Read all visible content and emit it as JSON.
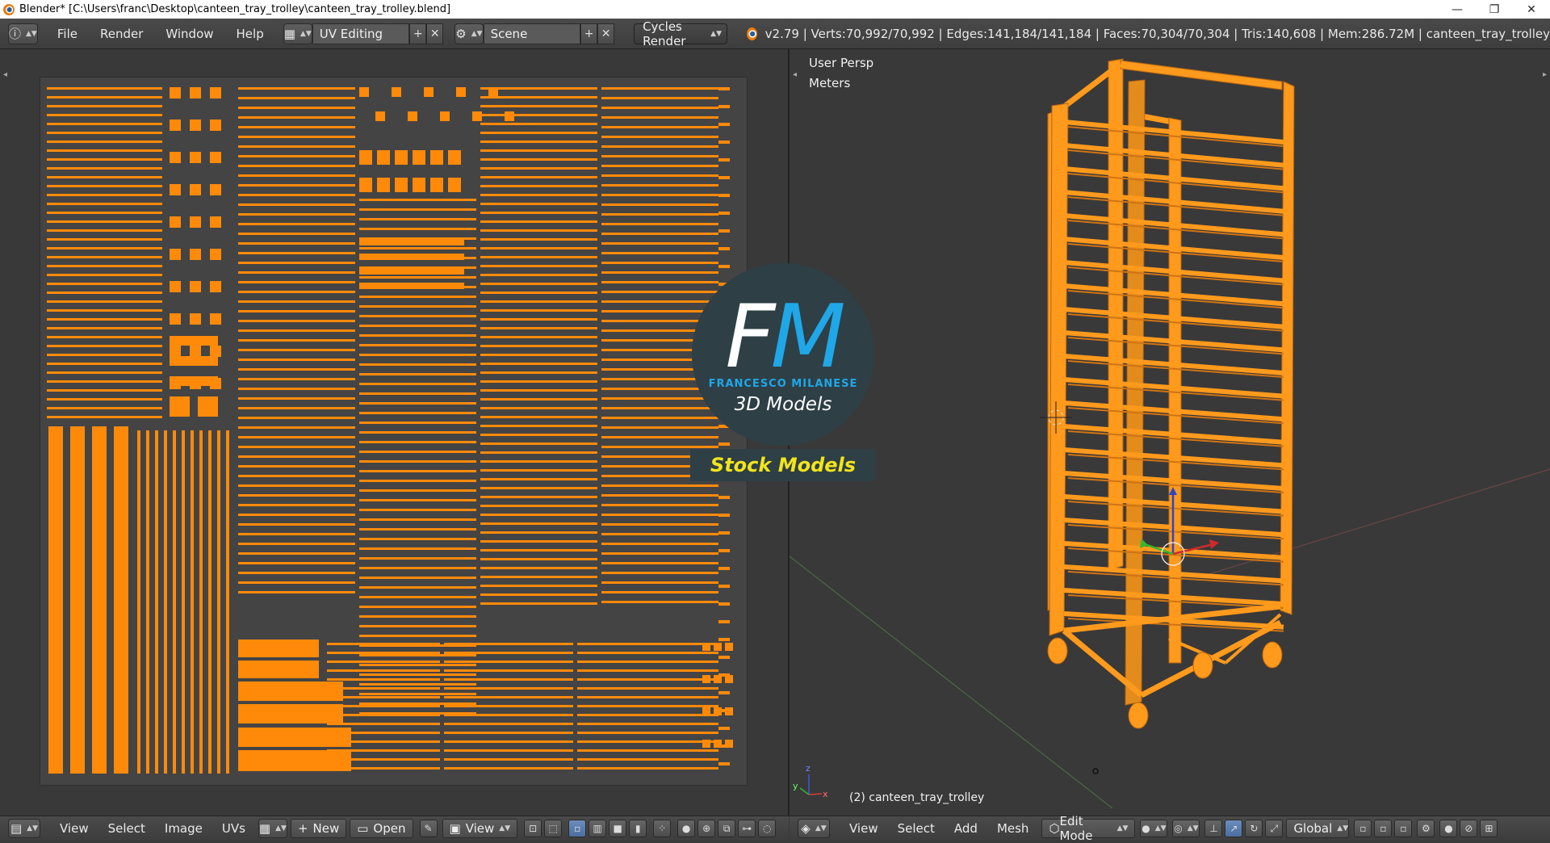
{
  "window": {
    "title": "Blender* [C:\\Users\\franc\\Desktop\\canteen_tray_trolley\\canteen_tray_trolley.blend]",
    "minimize": "—",
    "maximize": "❐",
    "close": "✕"
  },
  "header": {
    "menus": [
      "File",
      "Render",
      "Window",
      "Help"
    ],
    "layout": "UV Editing",
    "scene": "Scene",
    "render_engine": "Cycles Render",
    "stats": "v2.79 | Verts:70,992/70,992 | Edges:141,184/141,184 | Faces:70,304/70,304 | Tris:140,608 | Mem:286.72M | canteen_tray_trolley"
  },
  "viewport": {
    "view_name": "User Persp",
    "units": "Meters",
    "object_label": "(2) canteen_tray_trolley"
  },
  "watermark": {
    "initial_f": "F",
    "initial_m": "M",
    "name": "FRANCESCO MILANESE",
    "subtitle": "3D Models",
    "banner": "Stock Models",
    "colors": {
      "circle": "#2e3f46",
      "accent": "#1fa7e8",
      "banner_text": "#f2e41a"
    }
  },
  "uv_editor_bar": {
    "menus": [
      "View",
      "Select",
      "Image",
      "UVs"
    ],
    "new_label": "New",
    "open_label": "Open",
    "view_label": "View"
  },
  "viewport_bar": {
    "menus": [
      "View",
      "Select",
      "Add",
      "Mesh"
    ],
    "mode": "Edit Mode",
    "orientation": "Global"
  },
  "colors": {
    "uv_island": "#ff8a0a",
    "mesh": "#ff9a1c",
    "background": "#393939"
  }
}
